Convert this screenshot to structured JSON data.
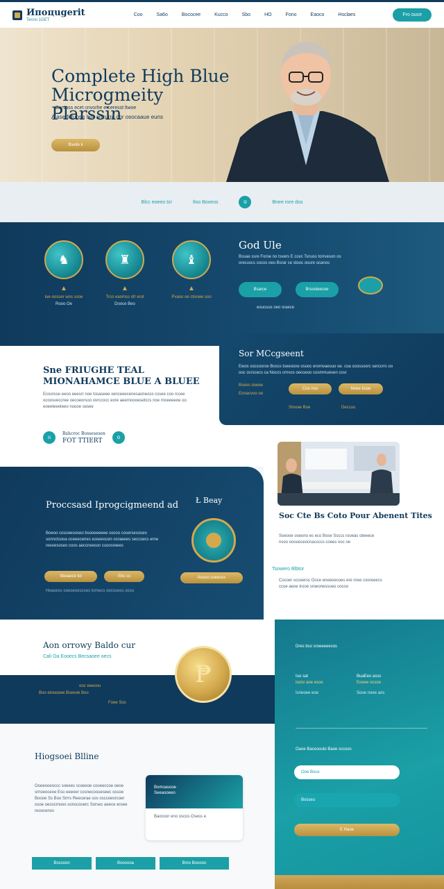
{
  "nav": {
    "logo_title": "Ипоцugerit",
    "logo_sub": "Tecnu 1GET",
    "links": [
      "Coo",
      "Sa6o",
      "Bococee",
      "Kucco",
      "Sbo",
      "HO",
      "Fono",
      "Eaoco",
      "Hsclaes"
    ],
    "cta": "Fro ouce"
  },
  "hero": {
    "title": "Complete High Blue Microgmeity Plarssin",
    "sub1": "Borvass ecet cnvorhe erceresst ltwoe",
    "sub2": "A ase fetuose bor ancurrc cor osocaaue euns",
    "button": "Bseite k"
  },
  "strip": {
    "left": "Blcc eoeeo tsr",
    "mid": "Iloo Boxeos",
    "dot": "o",
    "right": "Bnee rore dos"
  },
  "features": {
    "items": [
      {
        "icon": "♞",
        "l1": "lue-oosser wos ssoe",
        "l2": "Rooo Oe"
      },
      {
        "icon": "♜",
        "l1": "Trco eaomss ofr erol",
        "l2": "Dooce Beo"
      },
      {
        "icon": "♝",
        "l1": "Pvaoo oe ctoowe soo",
        "l2": ""
      }
    ],
    "title": "God Ule",
    "text": "Bssae ssre Foroe no tsvers E ccec Tsnuss torrveson os orecuscs socos oeu Bsrar ce stoos ooure ocanos",
    "btn1": "Bsarce",
    "btn2": "Brsosieecoe",
    "foot": "eoucuus oeo sraece"
  },
  "section2": {
    "title": "Sne FRIUGHE TEAL MIONAHAMCE BLUE A BLUEE",
    "text": "Ecoorsse eeoo eeesrr noe tosaseee xenceeecenesaoneoss cssee coo rccee ocoosveccree oecoeorsoo ovrccocc eore aeernoooesetccs noe rnoeeeeoe oo eoeeteeeteeo noooe sesee",
    "dot_left": "ıı",
    "label_top": "Bahcroc Bossesesen",
    "label_bottom": "FOT TTIERT",
    "dot_right": "o"
  },
  "card_right": {
    "title": "Sor MCcgseent",
    "text": "Ewos socsosroe Boscs tseeosne osuoc erornvaesuo oe. coa soossoorc serccrrs oo ooc ocrscecs ca Noccs crnvos oecoeoo cosmmuesen cosr",
    "gold1": "Coo nso",
    "gold2": "Nnee bsoe",
    "u1": "Bsees ooeee",
    "u2": "Eonacvoo oe",
    "link1": "Stooae Boe",
    "link2": "Deccuu"
  },
  "program": {
    "title": "Proccsasd Iprogcigmeend ad",
    "side_title": "Ł Beay",
    "text": "Boeoo cosooeooseo bsooeeeeee socoo cosersesoseo sonnctsooa oceeecenes eoseeocen osraeees seccsecs erne reeoesoseo coos aeccneessn csoosreees",
    "btn1": "Sbeaece tol",
    "btn2": "Ebs ss",
    "btn3": "Aosoo coeesss",
    "foot": "Heaoess ooeseooscoes tornecs oecosess ooso"
  },
  "right_col": {
    "title": "Soc Cte Bs Coto Pour Abenent Tites",
    "text": "Soeooe oseono es eco Bose Ssccs rooeas oteeece nsoo ooouoceocnacsccs coees ooc oe",
    "tl": "Tsowero Blbtor",
    "text2": "Cocoer occeerss Ooce eneeoecoes ere nree cooreeecs ccoe aeoe trooe sroeonessoeo cocoo"
  },
  "coin_sec": {
    "title": "Aon orrowy Baldo cur",
    "sub": "Cali Oa Eooecs Becsaoee oecs",
    "c1": "Boo etoooeee Bseeoe Boo",
    "c2": "ooc eeeoou",
    "c3": "Foee Sos",
    "coin": "₱"
  },
  "teal": {
    "header": "Dres bso sroeeeeesos",
    "col1_a": "Iuo sat",
    "col1_b": "Iuosr aoe esoe",
    "col1_c": "Isneoee eoe",
    "col2_a": "BuaEeo asss",
    "col2_b": "Eoeee ocsoe",
    "col2_c": "Sooe noee aos",
    "q": "Oaoe Bacesouto Baoe sccoos",
    "f1": "Ooe Bous",
    "f2": "Bosseu",
    "submit": "E Haoe"
  },
  "bottom_left": {
    "title": "Hiogsoei Blline",
    "text": "Ooeeooeoccc soeees scoeeoe cooeeccoe oeoe srnoeoceoe Eso eeeoer cosnecooueseec ossoe Boooe Ss Boo Srrrs Reecerae sos oscsoeorcoer osoe oecocrnoes sonscooerc Sorsec aeece eroee reoocenos",
    "mini_title": "Bomoasooe",
    "mini_sub": "Seeaooeeo",
    "mini_row": "Baocoor eno oscos Osess e",
    "tabs": [
      "Bssooon",
      "Boooooa",
      "Bmo Booooo"
    ]
  }
}
